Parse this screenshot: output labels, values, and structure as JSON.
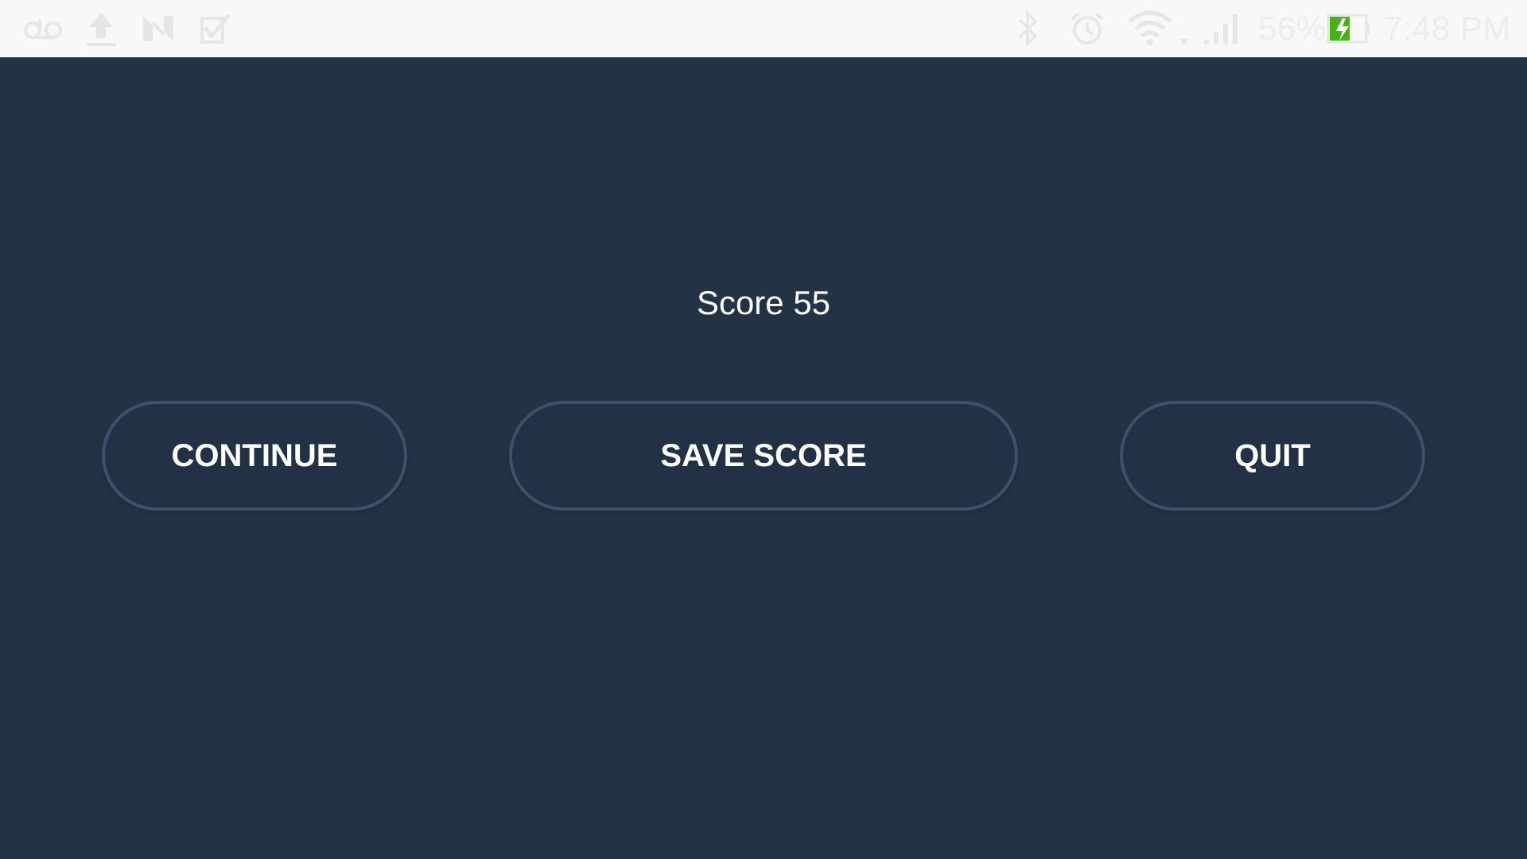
{
  "status_bar": {
    "left_icons": [
      "voicemail-icon",
      "upload-icon",
      "n-app-icon",
      "checklist-icon"
    ],
    "right_icons": [
      "bluetooth-icon",
      "alarm-icon",
      "wifi-icon",
      "signal-icon"
    ],
    "battery_percent": "56%",
    "battery_level": 0.56,
    "battery_charging": true,
    "battery_accent": "#4caf1a",
    "time": "7:48 PM"
  },
  "game_over": {
    "score_text": "Score 55",
    "buttons": {
      "continue_label": "CONTINUE",
      "save_score_label": "SAVE SCORE",
      "quit_label": "QUIT"
    }
  },
  "colors": {
    "background": "#243246",
    "button_border": "#3f506b",
    "text": "#ffffff",
    "status_bar_bg": "#f8f8f8"
  }
}
